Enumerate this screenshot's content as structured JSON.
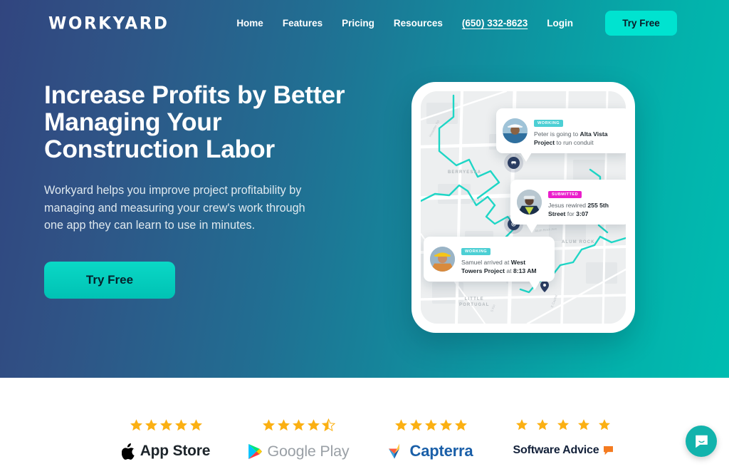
{
  "brand": {
    "logo_text": "WORKYARD"
  },
  "nav": {
    "links": [
      {
        "label": "Home",
        "name": "nav-link-home"
      },
      {
        "label": "Features",
        "name": "nav-link-features"
      },
      {
        "label": "Pricing",
        "name": "nav-link-pricing"
      },
      {
        "label": "Resources",
        "name": "nav-link-resources"
      },
      {
        "label": "(650) 332-8623",
        "name": "nav-link-phone"
      },
      {
        "label": "Login",
        "name": "nav-link-login"
      }
    ],
    "cta_label": "Try Free"
  },
  "hero": {
    "headline": "Increase Profits by Better\nManaging Your\nConstruction Labor",
    "subhead": "Workyard helps you improve project profitability by\nmanaging and measuring your crew's work through\none app they can learn to use in minutes.",
    "cta_label": "Try Free"
  },
  "map": {
    "area_labels": [
      "BERRYESSA",
      "ALUM ROCK",
      "LITTLE\nPORTUGAL"
    ],
    "street_labels": [
      "Hostetter Rd",
      "Sierra Rd",
      "N 28th St",
      "King Rd",
      "Alum Rock Ave",
      "S Kin",
      "E Capitol"
    ],
    "route_color": "#1ed6c6",
    "marker_color": "#2c3e63",
    "notifications": [
      {
        "badge": "WORKING",
        "badge_kind": "working",
        "text_pre": "Peter is going to ",
        "text_bold": "Alta Vista Project",
        "text_post": " to run conduit",
        "person": "Peter"
      },
      {
        "badge": "SUBMITTED",
        "badge_kind": "submitted",
        "text_pre": "Jesus rewired ",
        "text_bold": "255 5th Street",
        "text_post": " for ",
        "text_bold2": "3:07",
        "person": "Jesus"
      },
      {
        "badge": "WORKING",
        "badge_kind": "working",
        "text_pre": "Samuel arrived at ",
        "text_bold": "West Towers Project",
        "text_post": " at ",
        "text_bold2": "8:13 AM",
        "person": "Samuel"
      }
    ]
  },
  "ratings": [
    {
      "name": "App Store",
      "stars": 5,
      "half": false
    },
    {
      "name": "Google Play",
      "stars": 4,
      "half": true
    },
    {
      "name": "Capterra",
      "stars": 5,
      "half": false
    },
    {
      "name": "Software Advice",
      "stars": 5,
      "half": false
    }
  ],
  "chat": {
    "label": "chat-widget"
  },
  "colors": {
    "gradient_start": "#31457f",
    "gradient_end": "#00bdb1",
    "accent_cta": "#00e3d0",
    "star": "#fbb013",
    "badge_working": "#4ccfd4",
    "badge_submitted": "#ea1ecb"
  }
}
